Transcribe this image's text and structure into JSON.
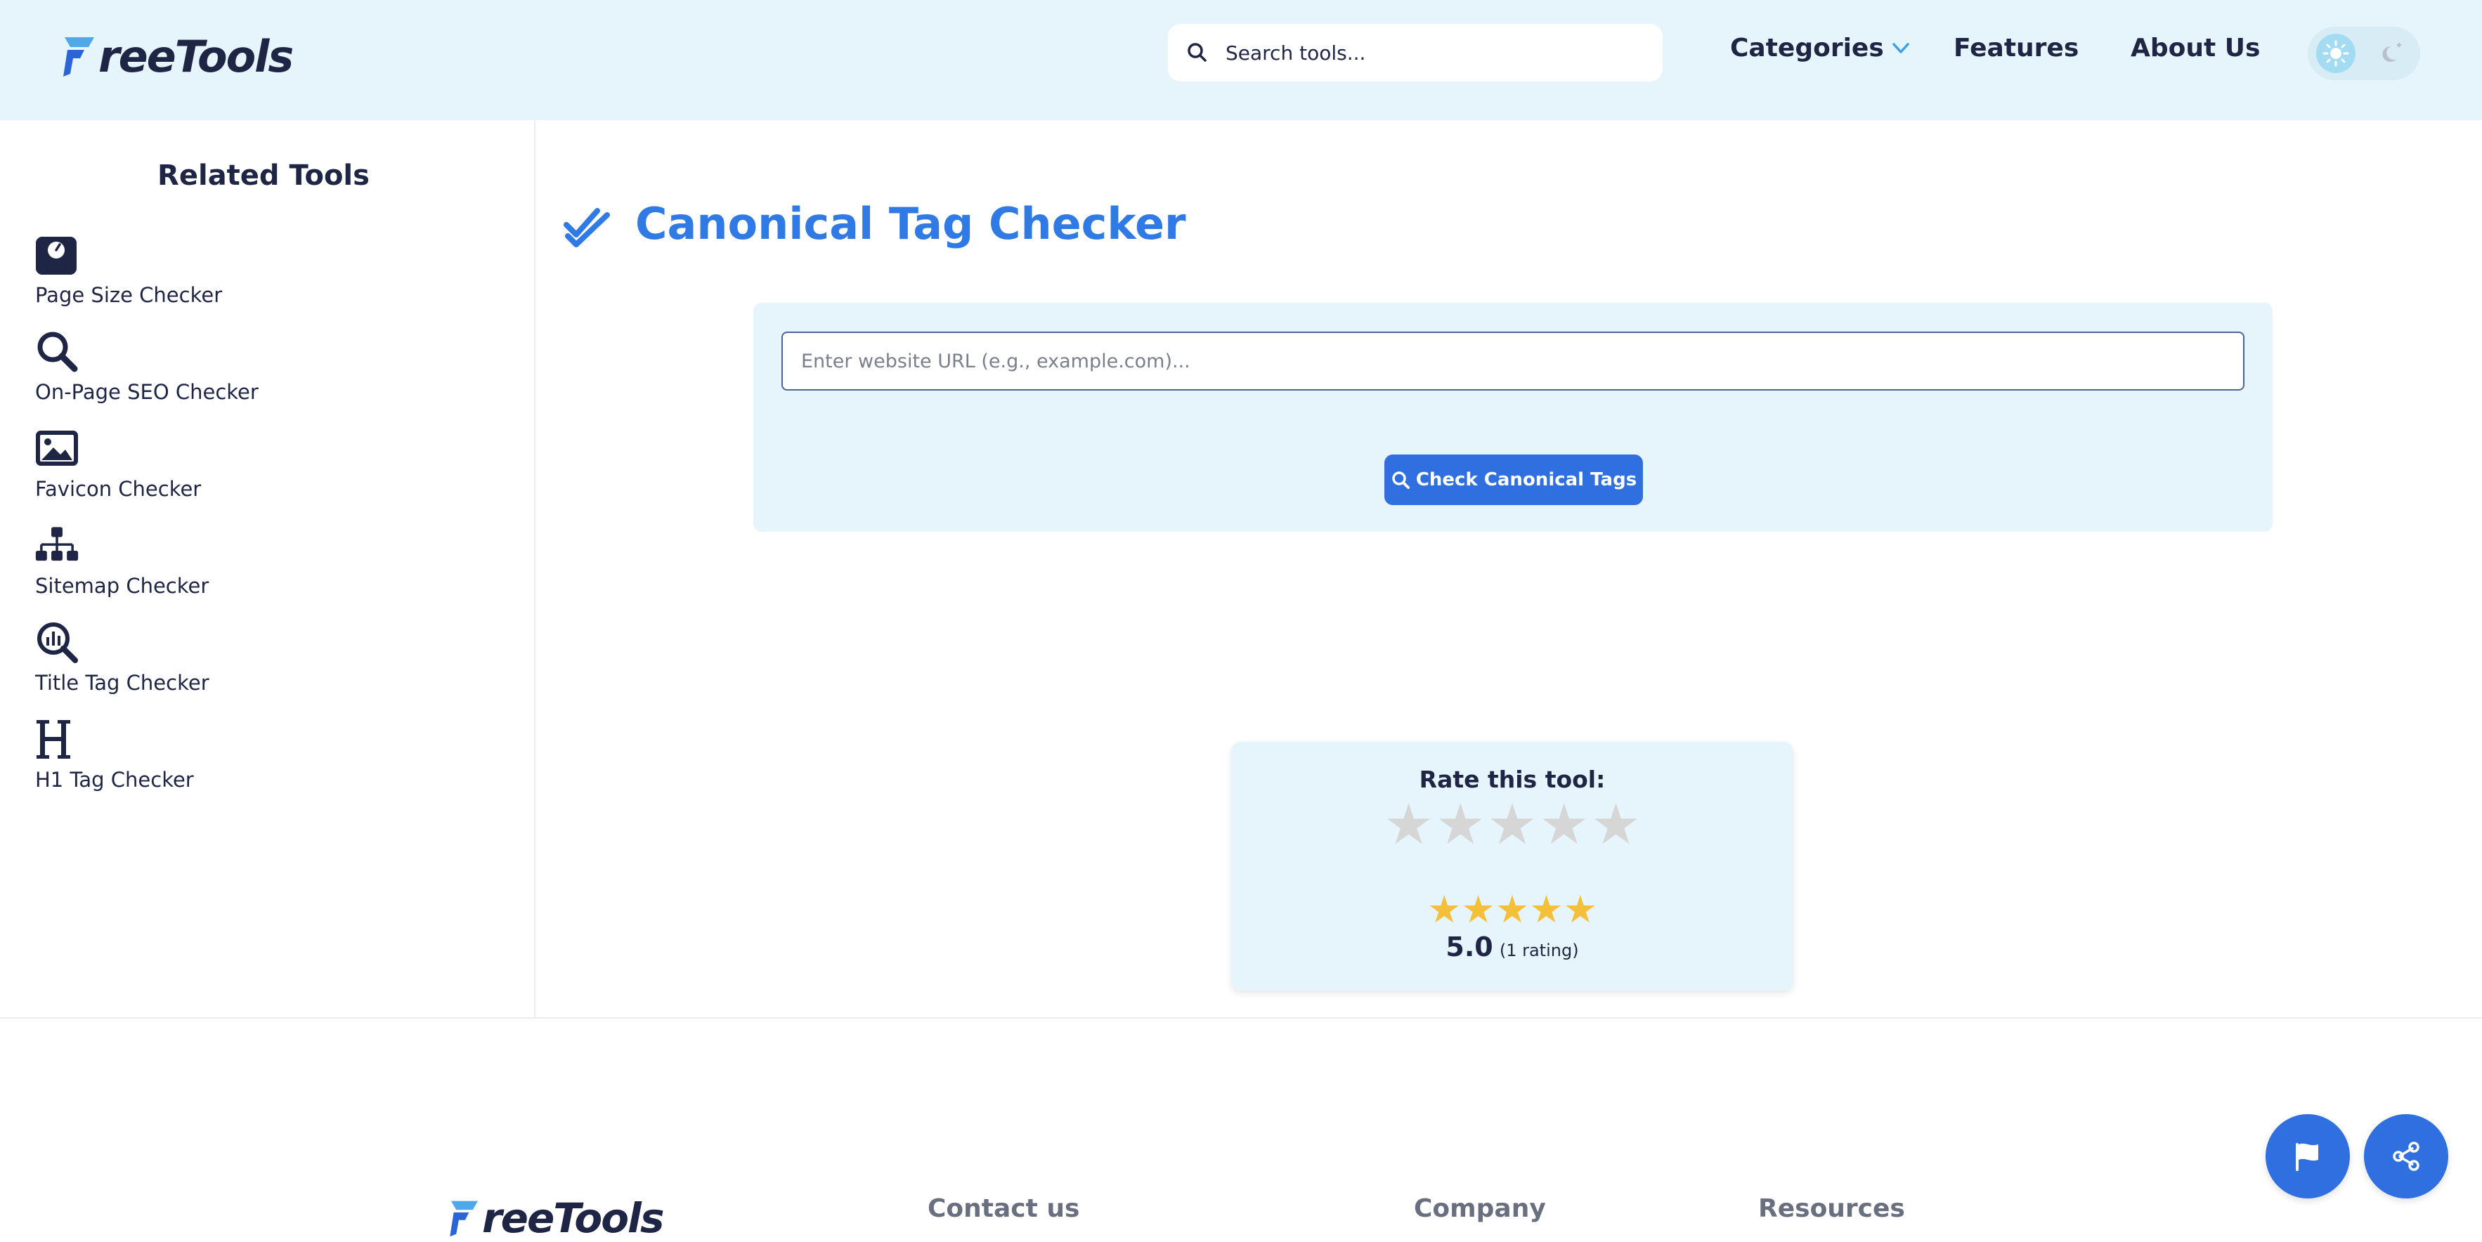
{
  "header": {
    "logo_text": "reeTools",
    "search_placeholder": "Search tools...",
    "nav": {
      "categories": "Categories",
      "features": "Features",
      "about": "About Us"
    }
  },
  "sidebar": {
    "title": "Related Tools",
    "items": [
      {
        "label": "Page Size Checker",
        "icon": "weight-scale-icon"
      },
      {
        "label": "On-Page SEO Checker",
        "icon": "magnifier-icon"
      },
      {
        "label": "Favicon Checker",
        "icon": "image-icon"
      },
      {
        "label": "Sitemap Checker",
        "icon": "sitemap-icon"
      },
      {
        "label": "Title Tag Checker",
        "icon": "search-chart-icon"
      },
      {
        "label": "H1 Tag Checker",
        "icon": "heading-icon"
      }
    ]
  },
  "main": {
    "title": "Canonical Tag Checker",
    "url_placeholder": "Enter website URL (e.g., example.com)...",
    "check_button": "Check Canonical Tags"
  },
  "rating": {
    "label": "Rate this tool:",
    "score": "5.0",
    "count": "(1 rating)",
    "average_stars": 5
  },
  "footer": {
    "logo_text": "reeTools",
    "headings": {
      "contact": "Contact us",
      "company": "Company",
      "resources": "Resources"
    }
  },
  "colors": {
    "accent": "#2f7ae5",
    "header_bg": "#e6f5fb",
    "star": "#f4bf3a"
  }
}
